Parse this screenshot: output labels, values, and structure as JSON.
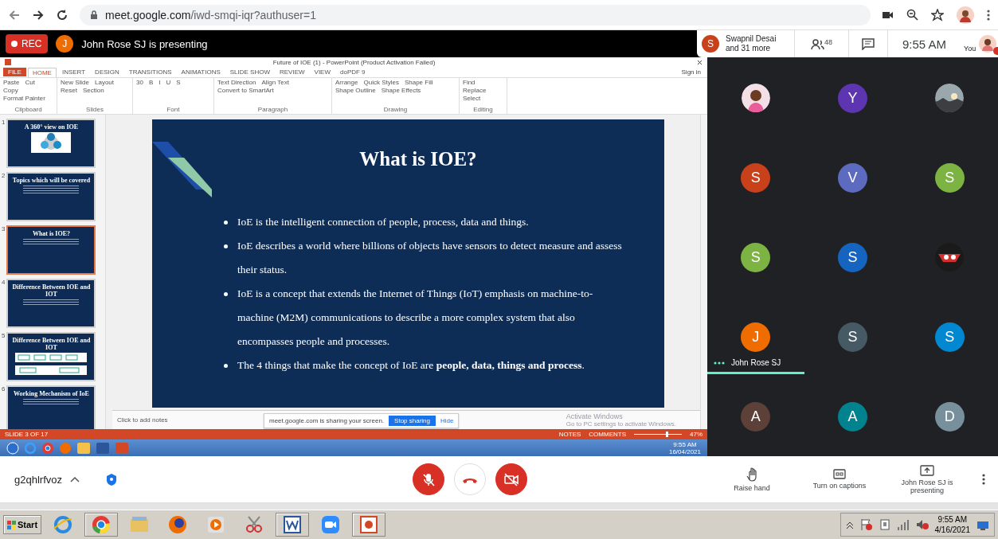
{
  "browser": {
    "url_host": "meet.google.com",
    "url_path": "/iwd-smqi-iqr?authuser=1"
  },
  "meeting_bar": {
    "recording_label": "REC",
    "presenter_initial": "J",
    "presenter_text": "John Rose SJ is presenting",
    "host_initial": "S",
    "host_name": "Swapnil Desai",
    "host_more": "and 31 more",
    "people_count": "48",
    "time": "9:55 AM",
    "self_label": "You"
  },
  "shared_screen": {
    "window_title": "Future of IOE (1) - PowerPoint (Product Activation Failed)",
    "sign_in": "Sign in",
    "ribbon_tabs": [
      {
        "label": "FILE",
        "selected": false,
        "kind": "file"
      },
      {
        "label": "HOME",
        "selected": true,
        "kind": "tab"
      },
      {
        "label": "INSERT",
        "selected": false,
        "kind": "tab"
      },
      {
        "label": "DESIGN",
        "selected": false,
        "kind": "tab"
      },
      {
        "label": "TRANSITIONS",
        "selected": false,
        "kind": "tab"
      },
      {
        "label": "ANIMATIONS",
        "selected": false,
        "kind": "tab"
      },
      {
        "label": "SLIDE SHOW",
        "selected": false,
        "kind": "tab"
      },
      {
        "label": "REVIEW",
        "selected": false,
        "kind": "tab"
      },
      {
        "label": "VIEW",
        "selected": false,
        "kind": "tab"
      },
      {
        "label": "doPDF 9",
        "selected": false,
        "kind": "tab"
      }
    ],
    "ribbon_groups": [
      {
        "label": "Clipboard",
        "commands": [
          "Paste",
          "Cut",
          "Copy",
          "Format Painter"
        ]
      },
      {
        "label": "Slides",
        "commands": [
          "New Slide",
          "Layout",
          "Reset",
          "Section"
        ]
      },
      {
        "label": "Font",
        "commands": [
          "30",
          "B",
          "I",
          "U",
          "S"
        ]
      },
      {
        "label": "Paragraph",
        "commands": [
          "Text Direction",
          "Align Text",
          "Convert to SmartArt"
        ]
      },
      {
        "label": "Drawing",
        "commands": [
          "Arrange",
          "Quick Styles",
          "Shape Fill",
          "Shape Outline",
          "Shape Effects"
        ]
      },
      {
        "label": "Editing",
        "commands": [
          "Find",
          "Replace",
          "Select"
        ]
      }
    ],
    "thumbnails": [
      {
        "number": "1",
        "title": "A 360° view on IOE",
        "selected": false,
        "kind": "diagram"
      },
      {
        "number": "2",
        "title": "Topics which will be covered",
        "selected": false,
        "kind": "list"
      },
      {
        "number": "3",
        "title": "What is IOE?",
        "selected": true,
        "kind": "text"
      },
      {
        "number": "4",
        "title": "Difference Between IOE and IOT",
        "selected": false,
        "kind": "text"
      },
      {
        "number": "5",
        "title": "Difference Between IOE and IOT",
        "selected": false,
        "kind": "flow"
      },
      {
        "number": "6",
        "title": "Working Mechanism of IoE",
        "selected": false,
        "kind": "text"
      }
    ],
    "slide": {
      "title": "What is IOE?",
      "bullets": [
        "IoE is the intelligent connection of people, process, data and things.",
        "IoE describes a world where billions of objects have sensors to detect measure and assess their status.",
        "IoE is a concept that extends the Internet of Things (IoT) emphasis on machine-to-machine (M2M) communications to describe a more complex system that also encompasses people and processes.",
        "The 4 things that make the concept of IoE are **people, data, things and process**."
      ]
    },
    "notes_placeholder": "Click to add notes",
    "share_notice": {
      "text": "meet.google.com is sharing your screen.",
      "stop": "Stop sharing",
      "hide": "Hide"
    },
    "activation": {
      "title": "Activate Windows",
      "text": "Go to PC settings to activate Windows."
    },
    "status_bar": {
      "slide_count": "SLIDE 3 OF 17",
      "notes": "NOTES",
      "comments": "COMMENTS",
      "zoom_slider": {
        "level": 0.7
      },
      "zoom": "47%"
    },
    "inner_taskbar": {
      "time": "9:55 AM",
      "date": "16/04/2021"
    }
  },
  "participants": [
    {
      "kind": "picture",
      "speaking": false
    },
    {
      "kind": "letter",
      "initial": "Y",
      "color": "#5e35b1",
      "speaking": false
    },
    {
      "kind": "picture",
      "speaking": false
    },
    {
      "kind": "letter",
      "initial": "S",
      "color": "#c8411b",
      "speaking": false
    },
    {
      "kind": "letter",
      "initial": "V",
      "color": "#5c6bc0",
      "speaking": false
    },
    {
      "kind": "letter",
      "initial": "S",
      "color": "#7cb342",
      "speaking": false
    },
    {
      "kind": "letter",
      "initial": "S",
      "color": "#7cb342",
      "speaking": false
    },
    {
      "kind": "letter",
      "initial": "S",
      "color": "#1565c0",
      "speaking": false
    },
    {
      "kind": "picture",
      "speaking": false
    },
    {
      "kind": "letter",
      "initial": "J",
      "color": "#ef6c00",
      "speaking": true,
      "name": "John Rose SJ"
    },
    {
      "kind": "letter",
      "initial": "S",
      "color": "#455a64",
      "speaking": false
    },
    {
      "kind": "letter",
      "initial": "S",
      "color": "#0288d1",
      "speaking": false
    },
    {
      "kind": "letter",
      "initial": "A",
      "color": "#5d4037",
      "speaking": false
    },
    {
      "kind": "letter",
      "initial": "A",
      "color": "#00838f",
      "speaking": false
    },
    {
      "kind": "letter",
      "initial": "D",
      "color": "#78909c",
      "speaking": false
    }
  ],
  "controls": {
    "meeting_code": "g2qhlrfvoz",
    "mic_muted": true,
    "camera_off": true,
    "raise_hand": "Raise hand",
    "captions": "Turn on captions",
    "presenting": "John Rose SJ is presenting"
  },
  "taskbar": {
    "start": "Start",
    "time": "9:55 AM",
    "date": "4/16/2021"
  }
}
